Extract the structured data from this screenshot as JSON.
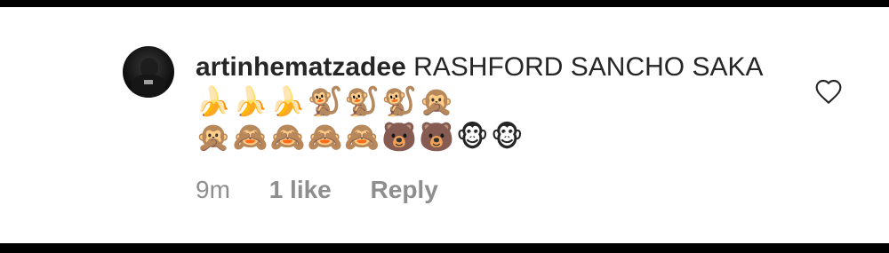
{
  "comment": {
    "username": "artinhematzadee",
    "text": "RASHFORD SANCHO SAKA",
    "emoji_line1": "🍌🍌🍌🐒🐒🐒🙊",
    "emoji_line2": "🙊🙈🙈🙈🙈🐻🐻🐵🐵",
    "time": "9m",
    "likes": "1 like",
    "reply_label": "Reply"
  },
  "icons": {
    "like": "heart-outline-icon",
    "avatar": "user-avatar"
  },
  "colors": {
    "text": "#262626",
    "meta": "#8e8e8e",
    "frame": "#000000"
  }
}
